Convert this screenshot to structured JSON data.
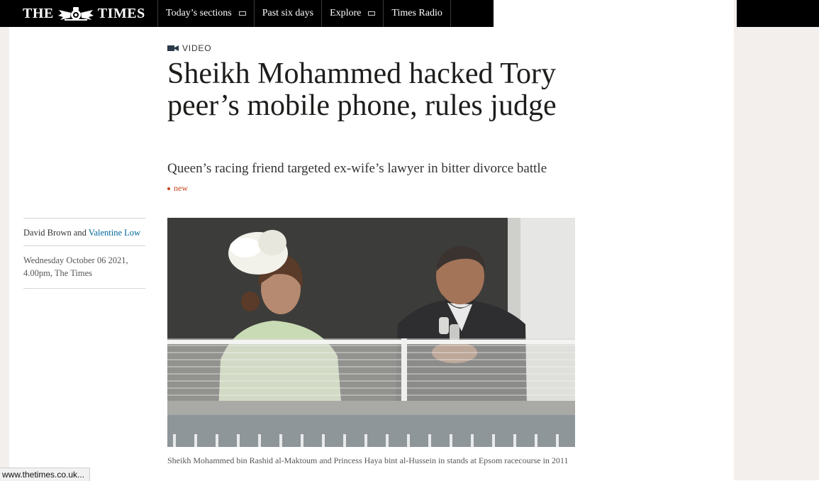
{
  "header": {
    "logo_left": "THE",
    "logo_right": "TIMES",
    "nav": [
      {
        "label": "Today’s sections",
        "icon": "menu-icon"
      },
      {
        "label": "Past six days",
        "icon": ""
      },
      {
        "label": "Explore",
        "icon": "menu-icon"
      },
      {
        "label": "Times Radio",
        "icon": ""
      }
    ]
  },
  "article": {
    "kicker": "VIDEO",
    "kicker_icon": "video-camera-icon",
    "headline": "Sheikh Mohammed hacked Tory peer’s mobile phone, rules judge",
    "standfirst": "Queen’s racing friend targeted ex-wife’s lawyer in bitter divorce battle",
    "new_label": "new",
    "byline": {
      "author1": "David Brown",
      "conjunction": "and",
      "author2": "Valentine Low",
      "dateline": "Wednesday October 06 2021, 4.00pm, The Times"
    },
    "caption": "Sheikh Mohammed bin Rashid al-Maktoum and Princess Haya bint al-Hussein in stands at Epsom racecourse in 2011"
  },
  "status_bar": {
    "url": "www.thetimes.co.uk..."
  },
  "colors": {
    "header_bg": "#000000",
    "link": "#006699",
    "accent_new": "#c4461d",
    "page_bg": "#f2efec"
  }
}
